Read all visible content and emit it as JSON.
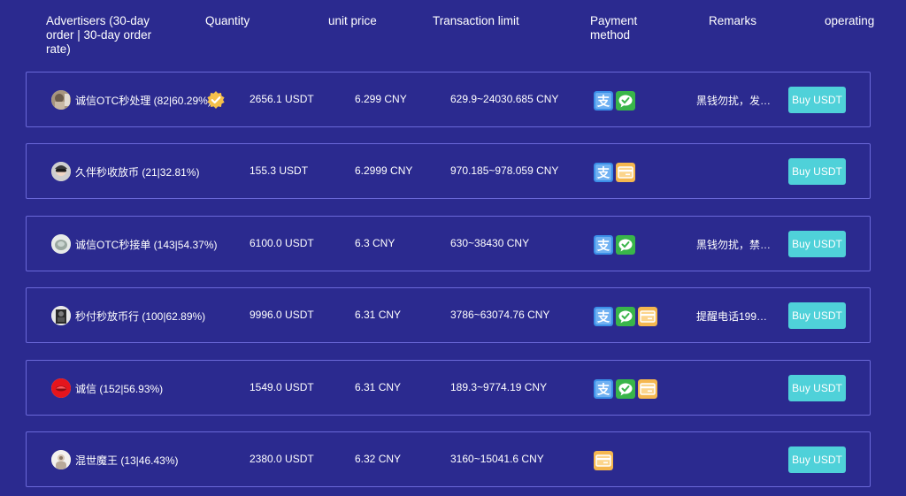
{
  "header": {
    "advertisers": "Advertisers (30-day order | 30-day order rate)",
    "quantity": "Quantity",
    "unit_price": "unit price",
    "transaction_limit": "Transaction limit",
    "payment_method": "Payment method",
    "remarks": "Remarks",
    "operating": "operating"
  },
  "colors": {
    "background": "#2b2a8f",
    "row_border": "#6a68d8",
    "buy_button": "#4fd1d9",
    "alipay": "#3b8fe8",
    "wechat": "#39b54a",
    "bank_card": "#f5b74f"
  },
  "rows": [
    {
      "advertiser": "诚信OTC秒处理 (82|60.29%)",
      "verified": true,
      "quantity": "2656.1 USDT",
      "price": "6.299 CNY",
      "limit": "629.9~24030.685 CNY",
      "payment_icons": [
        "alipay-icon",
        "wechat-pay-icon"
      ],
      "remarks": "黑钱勿扰，发…",
      "button": "Buy USDT"
    },
    {
      "advertiser": "久伴秒收放币 (21|32.81%)",
      "verified": false,
      "quantity": "155.3 USDT",
      "price": "6.2999 CNY",
      "limit": "970.185~978.059 CNY",
      "payment_icons": [
        "alipay-icon",
        "bank-card-icon"
      ],
      "remarks": "",
      "button": "Buy USDT"
    },
    {
      "advertiser": "诚信OTC秒接单 (143|54.37%)",
      "verified": false,
      "quantity": "6100.0 USDT",
      "price": "6.3 CNY",
      "limit": "630~38430 CNY",
      "payment_icons": [
        "alipay-icon",
        "wechat-pay-icon"
      ],
      "remarks": "黑钱勿扰，禁…",
      "button": "Buy USDT"
    },
    {
      "advertiser": "秒付秒放币行 (100|62.89%)",
      "verified": false,
      "quantity": "9996.0 USDT",
      "price": "6.31 CNY",
      "limit": "3786~63074.76 CNY",
      "payment_icons": [
        "alipay-icon",
        "wechat-pay-icon",
        "bank-card-icon"
      ],
      "remarks": "提醒电话199…",
      "button": "Buy USDT"
    },
    {
      "advertiser": "诚信 (152|56.93%)",
      "verified": false,
      "quantity": "1549.0 USDT",
      "price": "6.31 CNY",
      "limit": "189.3~9774.19 CNY",
      "payment_icons": [
        "alipay-icon",
        "wechat-pay-icon",
        "bank-card-icon"
      ],
      "remarks": "",
      "button": "Buy USDT"
    },
    {
      "advertiser": "混世魔王 (13|46.43%)",
      "verified": false,
      "quantity": "2380.0 USDT",
      "price": "6.32 CNY",
      "limit": "3160~15041.6 CNY",
      "payment_icons": [
        "bank-card-icon"
      ],
      "remarks": "",
      "button": "Buy USDT"
    }
  ]
}
